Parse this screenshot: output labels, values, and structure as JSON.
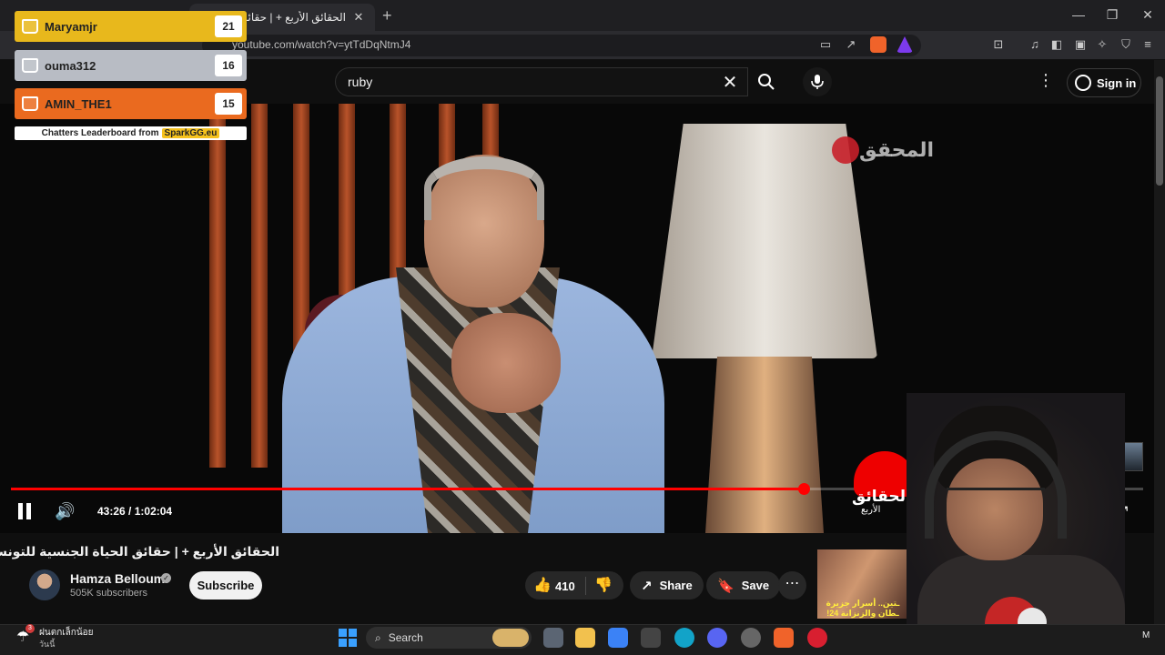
{
  "browser": {
    "tab_title": "الحقائق الأربع + | حقائق الحياة الجنسية للتونسي !",
    "tab_close": "✕",
    "new_tab": "+",
    "url": "youtube.com/watch?v=ytTdDqNtmJ4",
    "window_controls": {
      "minimize": "—",
      "restore": "❐",
      "close": "✕"
    }
  },
  "youtube": {
    "search_value": "ruby",
    "search_clear": "✕",
    "more": "⋮",
    "sign_in": "Sign in"
  },
  "video": {
    "watermark": "المحقق",
    "show_logo": "الحقائق",
    "show_logo_sub": "الأربع",
    "time_current": "43:26",
    "time_total": "1:02:04",
    "progress": 0.6999,
    "volume_icon": "🔊",
    "settings_icon": "⚙",
    "fullscreen_icon": "⤢"
  },
  "below": {
    "title": "الحقائق الأربع + | حقائق الحياة الجنسية للتونسي !",
    "channel_name": "Hamza Belloumi",
    "verified_mark": "✓",
    "subscribers": "505K subscribers",
    "subscribe": "Subscribe",
    "like_icon": "👍",
    "like_count": "410",
    "dislike_icon": "👎",
    "share_icon": "↗",
    "share": "Share",
    "save_icon": "🔖",
    "save": "Save",
    "more": "⋯",
    "side_thumb_text": "ـتين.. أسرار جزيرة ـطان والزنزانة 24!",
    "rail_more": "⋮"
  },
  "leaderboard": {
    "rows": [
      {
        "name": "Maryamjr",
        "score": "21",
        "color": "#e8b81c"
      },
      {
        "name": "ouma312",
        "score": "16",
        "color": "#b8bcc4"
      },
      {
        "name": "AMIN_THE1",
        "score": "15",
        "color": "#ea6a1f"
      }
    ],
    "footer": "Chatters Leaderboard from",
    "brand": "SparkGG.eu"
  },
  "taskbar": {
    "weather_badge": "3",
    "weather_line1": "ฝนตกเล็กน้อย",
    "weather_line2": "วันนี้",
    "search": "Search",
    "search_icon": "⌕",
    "lang": "M"
  }
}
